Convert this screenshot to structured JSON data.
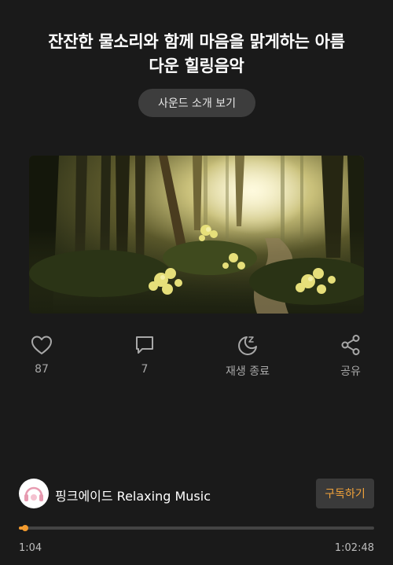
{
  "track": {
    "title_line1": "잔잔한 물소리와 함께 마음을 맑게하는 아름",
    "title_line2": "다운 힐링음악"
  },
  "sound_intro_button": "사운드 소개 보기",
  "actions": [
    {
      "icon": "heart-icon",
      "label": "87"
    },
    {
      "icon": "comment-icon",
      "label": "7"
    },
    {
      "icon": "sleep-timer-icon",
      "label": "재생 종료"
    },
    {
      "icon": "share-icon",
      "label": "공유"
    }
  ],
  "channel": {
    "name": "핑크에이드 Relaxing Music",
    "subscribe_label": "구독하기"
  },
  "player": {
    "elapsed": "1:04",
    "duration": "1:02:48",
    "progress_fraction": 0.017
  },
  "colors": {
    "background": "#1a1a1a",
    "accent": "#f29a2e",
    "subscribe_text": "#f2a33a"
  }
}
